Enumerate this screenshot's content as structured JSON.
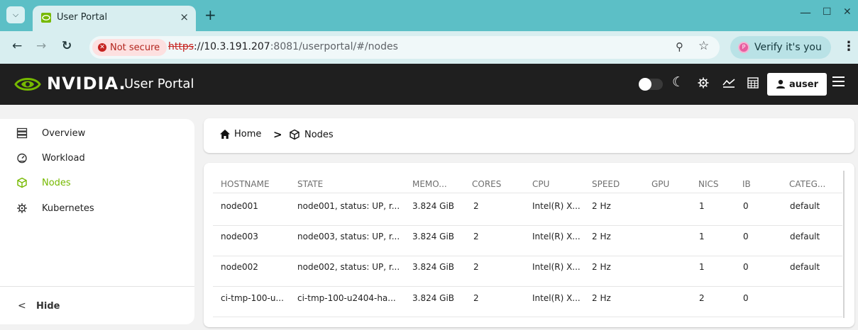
{
  "browser": {
    "tab_title": "User Portal",
    "tab_close": "×",
    "new_tab": "+",
    "tab_menu_icon": "chevron-down-icon",
    "not_secure_label": "Not secure",
    "url_scheme": "https",
    "url_host": "://10.3.191.207",
    "url_path": ":8081/userportal/#/nodes",
    "verify_label": "Verify it's you",
    "minimize": "—",
    "maximize": "☐",
    "close": "✕"
  },
  "header": {
    "brand": "NVIDIA.",
    "portal_title": "User Portal",
    "user_label": "auser",
    "brand_color": "#76b900"
  },
  "sidebar": {
    "items": [
      {
        "label": "Overview",
        "icon": "server-icon"
      },
      {
        "label": "Workload",
        "icon": "gauge-icon"
      },
      {
        "label": "Nodes",
        "icon": "cube-icon",
        "active": true
      },
      {
        "label": "Kubernetes",
        "icon": "helm-icon"
      }
    ],
    "hide_label": "Hide",
    "hide_icon": "chevron-left-icon"
  },
  "breadcrumb": {
    "home": "Home",
    "current": "Nodes"
  },
  "table": {
    "columns": [
      "HOSTNAME",
      "STATE",
      "MEMO...",
      "CORES",
      "CPU",
      "SPEED",
      "GPU",
      "NICS",
      "IB",
      "CATEG..."
    ],
    "rows": [
      [
        "node001",
        "node001, status: UP, r...",
        "3.824 GiB",
        "2",
        "Intel(R) X...",
        "2 Hz",
        "",
        "1",
        "0",
        "default"
      ],
      [
        "node003",
        "node003, status: UP, r...",
        "3.824 GiB",
        "2",
        "Intel(R) X...",
        "2 Hz",
        "",
        "1",
        "0",
        "default"
      ],
      [
        "node002",
        "node002, status: UP, r...",
        "3.824 GiB",
        "2",
        "Intel(R) X...",
        "2 Hz",
        "",
        "1",
        "0",
        "default"
      ],
      [
        "ci-tmp-100-u...",
        "ci-tmp-100-u2404-ha...",
        "3.824 GiB",
        "2",
        "Intel(R) X...",
        "2 Hz",
        "",
        "2",
        "0",
        ""
      ]
    ]
  }
}
